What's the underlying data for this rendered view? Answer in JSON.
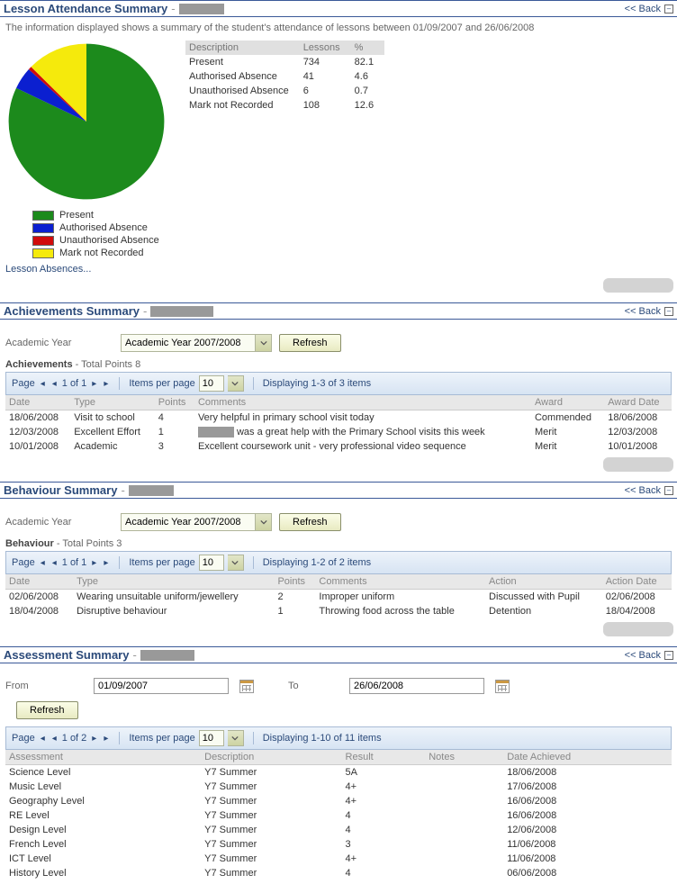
{
  "back_label": "<< Back",
  "attendance": {
    "title": "Lesson Attendance Summary",
    "intro": "The information displayed shows a summary of the student's attendance of lessons between 01/09/2007 and 26/06/2008",
    "columns": [
      "Description",
      "Lessons",
      "%"
    ],
    "rows": [
      {
        "desc": "Present",
        "lessons": "734",
        "pct": "82.1",
        "color": "#1c8a1c"
      },
      {
        "desc": "Authorised Absence",
        "lessons": "41",
        "pct": "4.6",
        "color": "#0b1fd0"
      },
      {
        "desc": "Unauthorised Absence",
        "lessons": "6",
        "pct": "0.7",
        "color": "#d10b0b"
      },
      {
        "desc": "Mark not Recorded",
        "lessons": "108",
        "pct": "12.6",
        "color": "#f5ea0c"
      }
    ],
    "link": "Lesson Absences..."
  },
  "chart_data": {
    "type": "pie",
    "title": "",
    "slices": [
      {
        "label": "Present",
        "value": 82.1,
        "color": "#1c8a1c"
      },
      {
        "label": "Authorised Absence",
        "value": 4.6,
        "color": "#0b1fd0"
      },
      {
        "label": "Unauthorised Absence",
        "value": 0.7,
        "color": "#d10b0b"
      },
      {
        "label": "Mark not Recorded",
        "value": 12.6,
        "color": "#f5ea0c"
      }
    ]
  },
  "achievements": {
    "title": "Achievements Summary",
    "year_label": "Academic Year",
    "year_value": "Academic Year 2007/2008",
    "refresh": "Refresh",
    "summary_prefix": "Achievements",
    "summary_suffix": " - Total Points 8",
    "pager": {
      "page_label": "Page",
      "page_text": "1 of 1",
      "ipp_label": "Items per page",
      "ipp_value": "10",
      "status": "Displaying 1-3 of 3 items"
    },
    "columns": [
      "Date",
      "Type",
      "Points",
      "Comments",
      "Award",
      "Award Date"
    ],
    "rows": [
      {
        "date": "18/06/2008",
        "type": "Visit to school",
        "points": "4",
        "comments": "Very helpful in primary school visit today",
        "award": "Commended",
        "award_date": "18/06/2008",
        "redact_prefix": false
      },
      {
        "date": "12/03/2008",
        "type": "Excellent Effort",
        "points": "1",
        "comments": "was a great help with the Primary School visits this week",
        "award": "Merit",
        "award_date": "12/03/2008",
        "redact_prefix": true
      },
      {
        "date": "10/01/2008",
        "type": "Academic",
        "points": "3",
        "comments": "Excellent coursework unit - very professional video sequence",
        "award": "Merit",
        "award_date": "10/01/2008",
        "redact_prefix": false
      }
    ]
  },
  "behaviour": {
    "title": "Behaviour Summary",
    "year_label": "Academic Year",
    "year_value": "Academic Year 2007/2008",
    "refresh": "Refresh",
    "summary_prefix": "Behaviour",
    "summary_suffix": " - Total Points 3",
    "pager": {
      "page_label": "Page",
      "page_text": "1 of 1",
      "ipp_label": "Items per page",
      "ipp_value": "10",
      "status": "Displaying 1-2 of 2 items"
    },
    "columns": [
      "Date",
      "Type",
      "Points",
      "Comments",
      "Action",
      "Action Date"
    ],
    "rows": [
      {
        "date": "02/06/2008",
        "type": "Wearing unsuitable uniform/jewellery",
        "points": "2",
        "comments": "Improper uniform",
        "action": "Discussed with Pupil",
        "action_date": "02/06/2008"
      },
      {
        "date": "18/04/2008",
        "type": "Disruptive behaviour",
        "points": "1",
        "comments": "Throwing food across the table",
        "action": "Detention",
        "action_date": "18/04/2008"
      }
    ]
  },
  "assessment": {
    "title": "Assessment Summary",
    "from_label": "From",
    "to_label": "To",
    "from_value": "01/09/2007",
    "to_value": "26/06/2008",
    "refresh": "Refresh",
    "pager": {
      "page_label": "Page",
      "page_text": "1 of 2",
      "ipp_label": "Items per page",
      "ipp_value": "10",
      "status": "Displaying 1-10 of 11 items"
    },
    "columns": [
      "Assessment",
      "Description",
      "Result",
      "Notes",
      "Date Achieved"
    ],
    "rows": [
      {
        "a": "Science Level",
        "d": "Y7 Summer",
        "r": "5A",
        "n": "",
        "dt": "18/06/2008"
      },
      {
        "a": "Music Level",
        "d": "Y7 Summer",
        "r": "4+",
        "n": "",
        "dt": "17/06/2008"
      },
      {
        "a": "Geography Level",
        "d": "Y7 Summer",
        "r": "4+",
        "n": "",
        "dt": "16/06/2008"
      },
      {
        "a": "RE Level",
        "d": "Y7 Summer",
        "r": "4",
        "n": "",
        "dt": "16/06/2008"
      },
      {
        "a": "Design Level",
        "d": "Y7 Summer",
        "r": "4",
        "n": "",
        "dt": "12/06/2008"
      },
      {
        "a": "French Level",
        "d": "Y7 Summer",
        "r": "3",
        "n": "",
        "dt": "11/06/2008"
      },
      {
        "a": "ICT Level",
        "d": "Y7 Summer",
        "r": "4+",
        "n": "",
        "dt": "11/06/2008"
      },
      {
        "a": "History Level",
        "d": "Y7 Summer",
        "r": "4",
        "n": "",
        "dt": "06/06/2008"
      }
    ]
  }
}
